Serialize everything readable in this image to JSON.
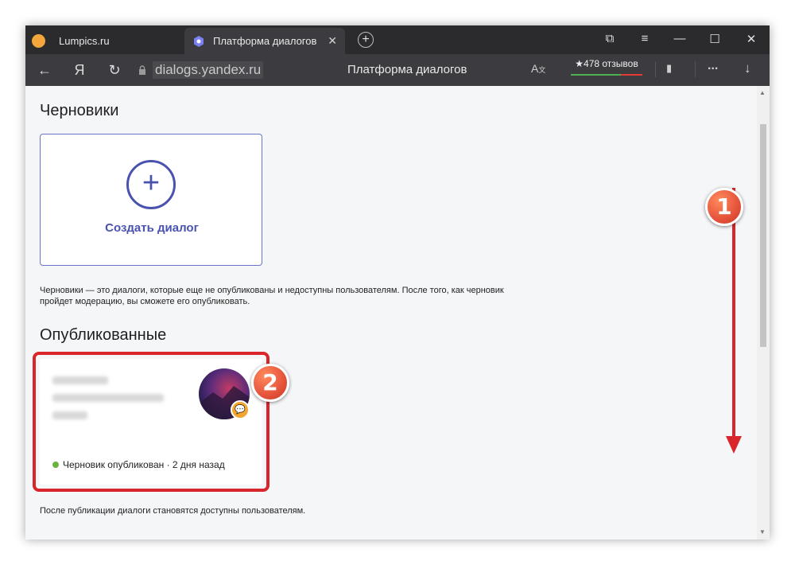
{
  "browser": {
    "tabs": [
      {
        "title": "Lumpics.ru",
        "active": false,
        "favicon": "orange-circle-icon"
      },
      {
        "title": "Платформа диалогов",
        "active": true,
        "favicon": "yandex-dialogs-icon"
      }
    ],
    "close_glyph": "✕",
    "newtab_glyph": "+",
    "controls": {
      "bookmarks": "⧉",
      "menu": "≡",
      "minimize": "—",
      "maximize": "☐",
      "close": "✕"
    },
    "nav": {
      "back": "←",
      "yandex": "Я",
      "reload": "↻"
    },
    "url": "dialogs.yandex.ru",
    "page_title": "Платформа диалогов",
    "reviews": "★478 отзывов",
    "more": "...",
    "download": "↓"
  },
  "page": {
    "drafts_heading": "Черновики",
    "create_label": "Создать диалог",
    "plus_glyph": "+",
    "drafts_note": "Черновики — это диалоги, которые еще не опубликованы и недоступны пользователям. После того, как черновик пройдет модерацию, вы сможете его опубликовать.",
    "published_heading": "Опубликованные",
    "card_status": "Черновик опубликован · 2 дня назад",
    "published_note": "После публикации диалоги становятся доступны пользователям."
  },
  "annotations": {
    "step1": "1",
    "step2": "2",
    "color": "#d9262c"
  }
}
